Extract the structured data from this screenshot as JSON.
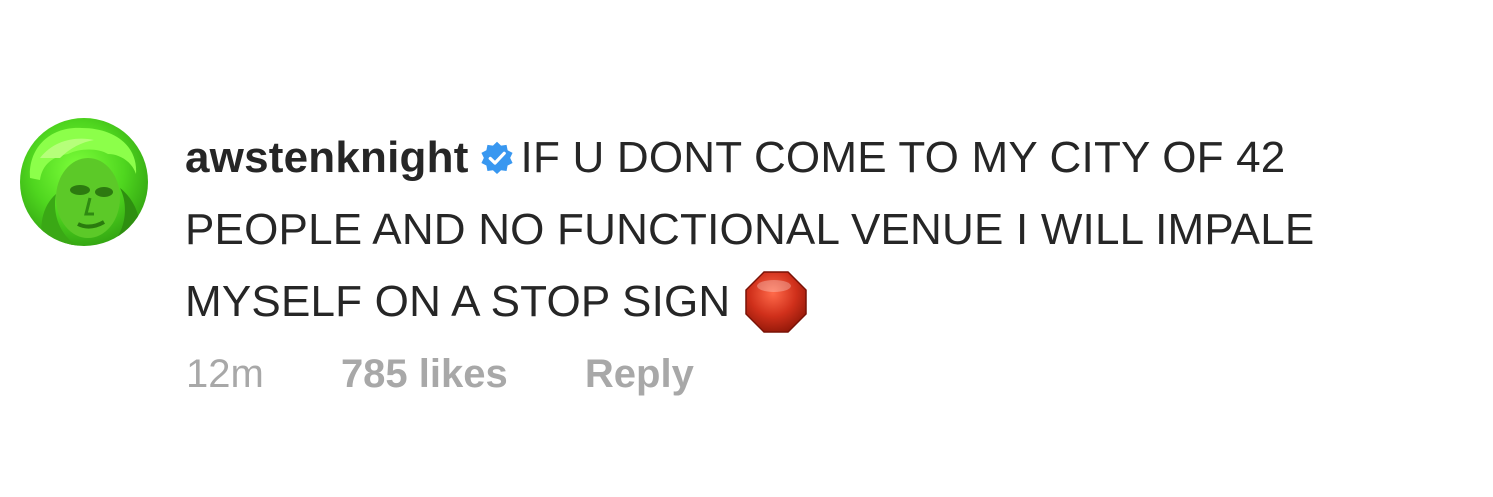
{
  "comment": {
    "username": "awstenknight",
    "verified": true,
    "text": "IF U DONT COME TO MY CITY OF 42 PEOPLE AND NO FUNCTIONAL VENUE I WILL IMPALE MYSELF ON A STOP SIGN",
    "emoji": "stop-sign-icon",
    "time": "12m",
    "likes": "785 likes",
    "reply_label": "Reply"
  },
  "colors": {
    "text": "#262626",
    "meta": "#a8a8a8",
    "verified_blue": "#3897f0",
    "stop_red": "#d0301b",
    "avatar_green": "#4fd61f"
  }
}
